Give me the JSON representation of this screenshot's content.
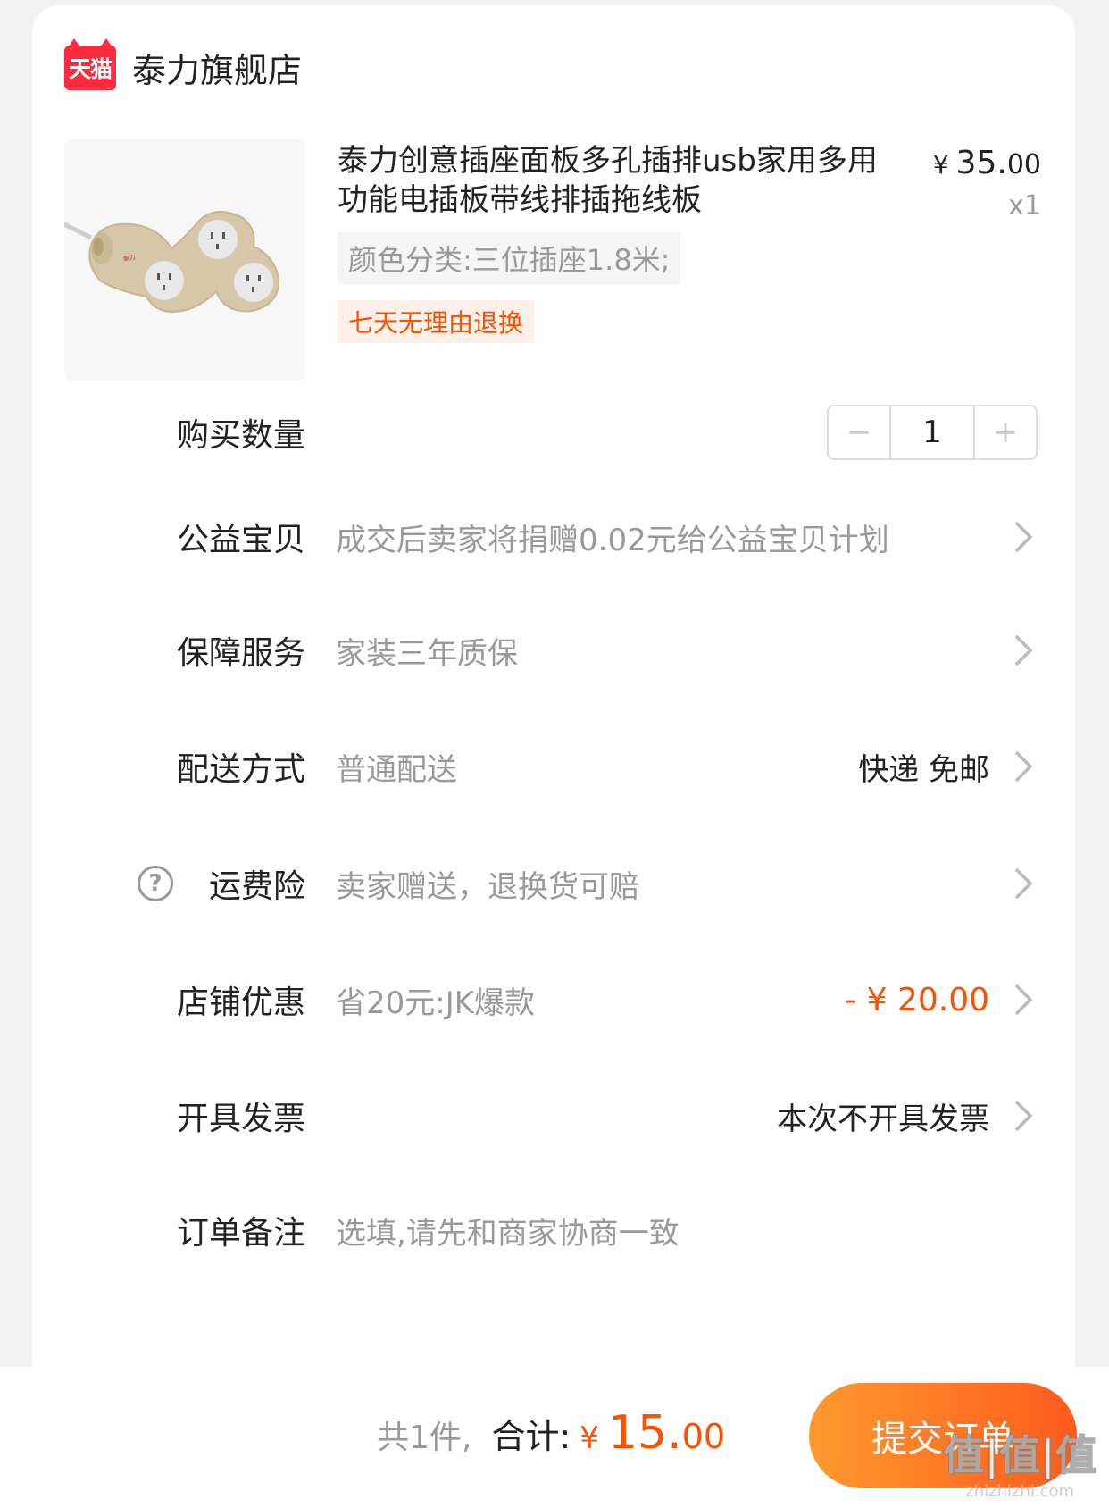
{
  "store": {
    "logo_text": "天猫",
    "name": "泰力旗舰店"
  },
  "product": {
    "title": "泰力创意插座面板多孔插排usb家用多用功能电插板带线排插拖线板",
    "price_yen": "¥",
    "price_main": "35.",
    "price_cents": "00",
    "quantity_mark": "x1",
    "sku": "颜色分类:三位插座1.8米;",
    "return_policy": "七天无理由退换"
  },
  "rows": {
    "quantity": {
      "label": "购买数量",
      "minus": "−",
      "value": "1",
      "plus": "+"
    },
    "charity": {
      "label": "公益宝贝",
      "desc": "成交后卖家将捐赠0.02元给公益宝贝计划"
    },
    "guarantee": {
      "label": "保障服务",
      "desc": "家装三年质保"
    },
    "delivery": {
      "label": "配送方式",
      "desc": "普通配送",
      "value": "快递 免邮"
    },
    "insurance": {
      "label": "运费险",
      "icon": "?",
      "desc": "卖家赠送，退换货可赔"
    },
    "discount": {
      "label": "店铺优惠",
      "desc": "省20元:JK爆款",
      "value": "- ¥ 20.00"
    },
    "invoice": {
      "label": "开具发票",
      "value": "本次不开具发票"
    },
    "note": {
      "label": "订单备注",
      "placeholder": "选填,请先和商家协商一致"
    }
  },
  "footer": {
    "count": "共1件,",
    "total_label": "合计:",
    "yen": "¥",
    "total_main": "15.",
    "total_cents": "00",
    "submit": "提交订单"
  },
  "watermark": {
    "main": "值|值|值",
    "sub": "zhizhizhi.com"
  },
  "colors": {
    "accent": "#ff5000",
    "tmall_red": "#ff2a3c",
    "button_gradient_start": "#ff9a2e",
    "button_gradient_end": "#ff5a1e"
  }
}
